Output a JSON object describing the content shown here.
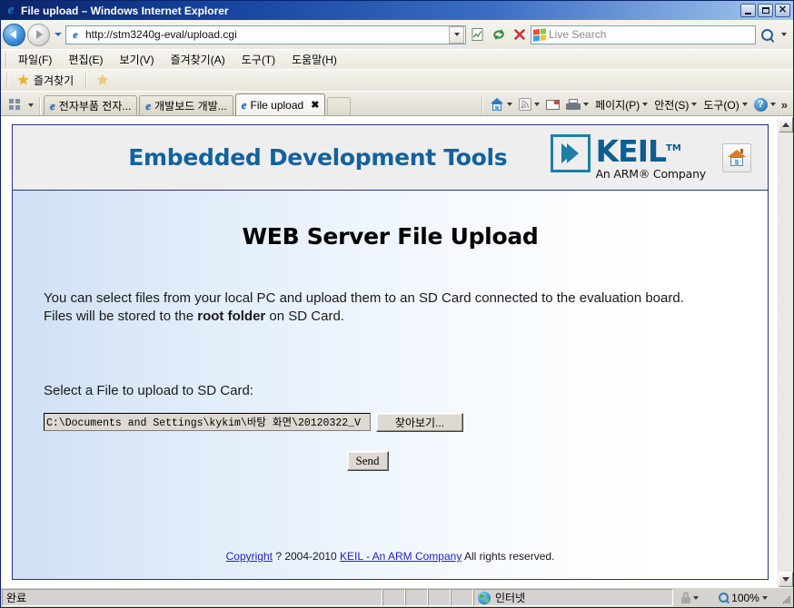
{
  "window": {
    "title": "File upload – Windows Internet Explorer",
    "icon": "ie-logo-icon",
    "minimize_label": "Minimize",
    "maximize_label": "Maximize",
    "close_label": "Close"
  },
  "address_bar": {
    "back_label": "Back",
    "forward_label": "Forward",
    "recent_label": "Recent Pages",
    "url": "http://stm3240g-eval/upload.cgi",
    "dropdown_label": "Address dropdown",
    "compat_label": "Compatibility View",
    "refresh_label": "Refresh",
    "stop_label": "Stop"
  },
  "search": {
    "placeholder": "Live Search",
    "value": "",
    "go_label": "Search",
    "options_label": "Search options"
  },
  "menu": {
    "items": [
      {
        "label": "파일(F)",
        "text": "파일(F)"
      },
      {
        "label": "편집(E)",
        "text": "편집(E)"
      },
      {
        "label": "보기(V)",
        "text": "보기(V)"
      },
      {
        "label": "즐겨찾기(A)",
        "text": "즐겨찾기(A)"
      },
      {
        "label": "도구(T)",
        "text": "도구(T)"
      },
      {
        "label": "도움말(H)",
        "text": "도움말(H)"
      }
    ]
  },
  "favorites_bar": {
    "favorites_label": "즐겨찾기",
    "add_label": "Add to Favorites Bar"
  },
  "tabs": {
    "quick_tabs_label": "Quick Tabs",
    "tab_list_label": "Tab List",
    "items": [
      {
        "label": "전자부품 전자...",
        "active": false
      },
      {
        "label": "개발보드 개발...",
        "active": false
      },
      {
        "label": "File upload",
        "active": true
      }
    ],
    "close_glyph": "✖",
    "new_tab_label": "New Tab"
  },
  "command_bar": {
    "home_label": "Home",
    "feeds_label": "Feeds",
    "mail_label": "Read Mail",
    "print_label": "Print",
    "page_label": "페이지(P)",
    "safety_label": "안전(S)",
    "tools_label": "도구(O)",
    "help_label": "도움말",
    "overflow_glyph": "»",
    "caret_glyph": "▾"
  },
  "page": {
    "brand_title": "Embedded Development Tools",
    "logo": {
      "word": "KEIL",
      "tm": "TM",
      "tagline": "An ARM® Company"
    },
    "home_button_label": "Home",
    "heading": "WEB Server File Upload",
    "intro_part1": "You can select files from your local PC and upload them to an SD Card connected to the evaluation board. Files will be stored to the ",
    "intro_bold": "root folder",
    "intro_part2": " on SD Card.",
    "select_label": "Select a File to upload to SD Card:",
    "file_value": "C:\\Documents and Settings\\kykim\\바탕 화면\\20120322_V",
    "browse_label": "찾아보기...",
    "send_label": "Send",
    "footer": {
      "copyright_link": "Copyright",
      "mid_text": " ? 2004-2010 ",
      "company_link": "KEIL - An ARM Company",
      "tail_text": " All rights reserved."
    }
  },
  "scrollbar": {
    "up_label": "Scroll up",
    "down_label": "Scroll down"
  },
  "status_bar": {
    "status": "완료",
    "zone": "인터넷",
    "zone_icon": "internet-globe-icon",
    "protected_label": "Protected Mode",
    "zoom": "100%",
    "caret_glyph": "▾"
  },
  "colors": {
    "title_bar_start": "#0a246a",
    "brand_blue": "#11639e",
    "keil_blue": "#0e5e91",
    "card_border": "#21348b",
    "link_blue": "#2222cc",
    "chrome_bg": "#f1efe7",
    "status_bg": "#d6d3ce"
  }
}
